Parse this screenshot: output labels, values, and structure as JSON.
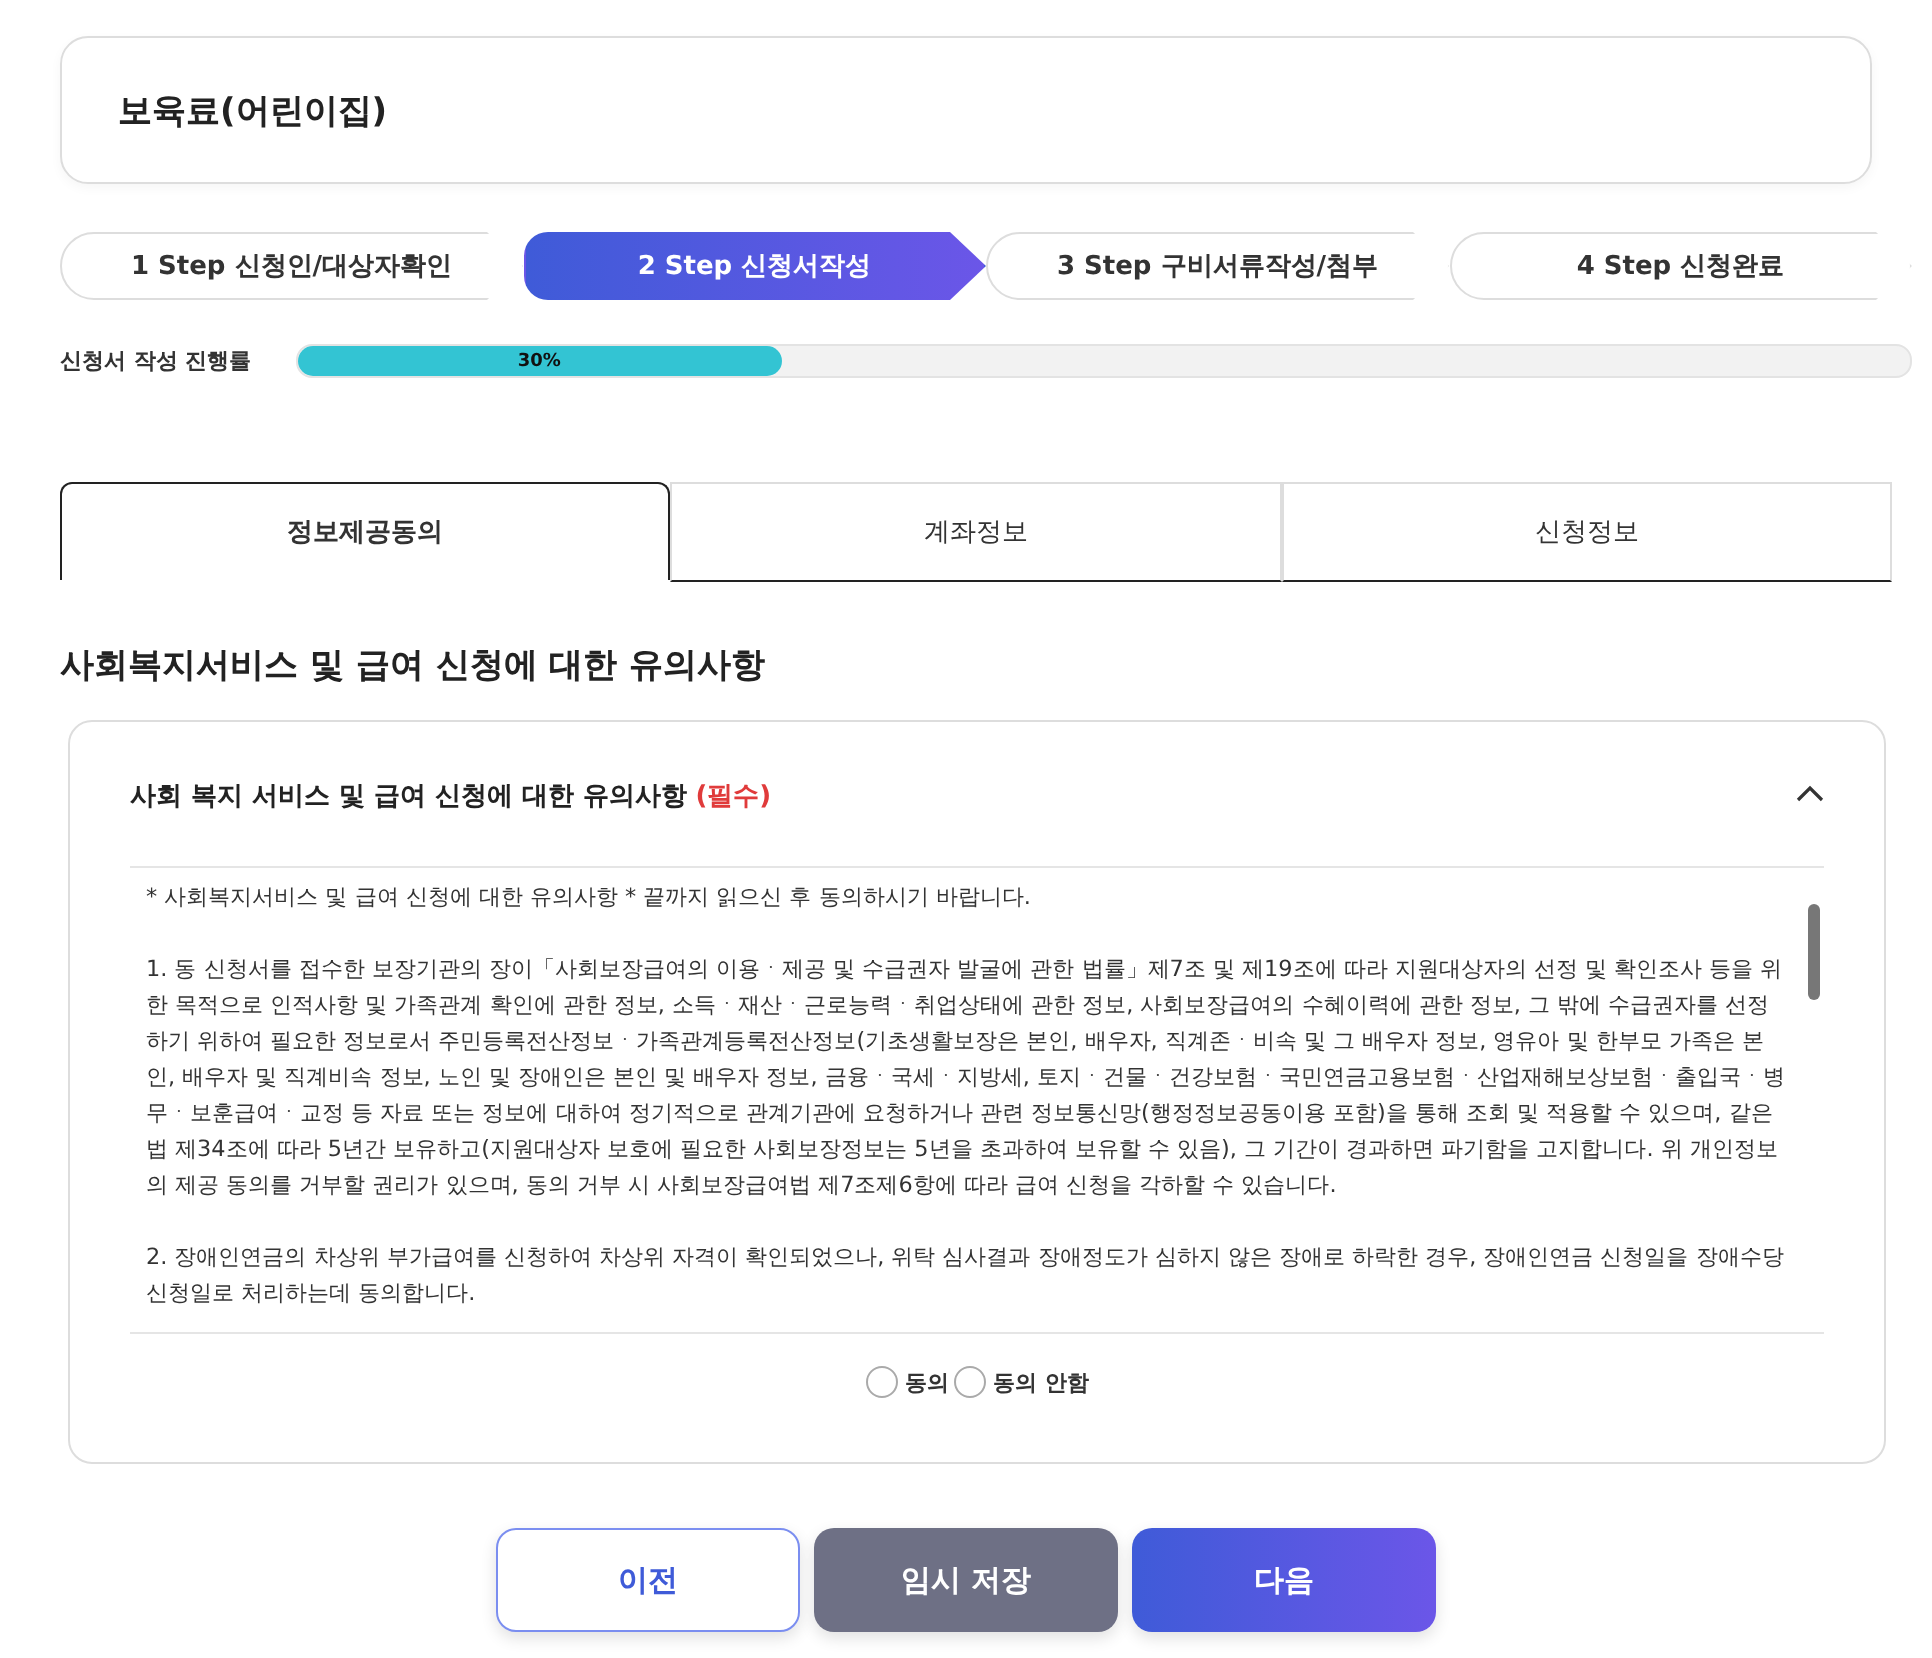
{
  "page_title": "보육료(어린이집)",
  "steps": [
    {
      "label": "1 Step 신청인/대상자확인",
      "selected": false
    },
    {
      "label": "2 Step 신청서작성",
      "selected": true
    },
    {
      "label": "3 Step 구비서류작성/첨부",
      "selected": false
    },
    {
      "label": "4 Step 신청완료",
      "selected": false
    }
  ],
  "progress": {
    "label": "신청서 작성 진행률",
    "level": 0.3,
    "reading": "30%"
  },
  "tabs": [
    {
      "label": "정보제공동의",
      "selected": true
    },
    {
      "label": "계좌정보",
      "selected": false
    },
    {
      "label": "신청정보",
      "selected": false
    }
  ],
  "section_title": "사회복지서비스 및 급여 신청에 대한 유의사항",
  "notice": {
    "title": "사회 복지 서비스 및 급여 신청에 대한 유의사항",
    "required_mark": "(필수)",
    "expanded": true,
    "paragraphs": [
      "* 사회복지서비스 및 급여 신청에 대한 유의사항 * 끝까지 읽으신 후 동의하시기 바랍니다.",
      "1. 동 신청서를 접수한 보장기관의 장이「사회보장급여의 이용ㆍ제공 및 수급권자 발굴에 관한 법률」제7조 및 제19조에 따라 지원대상자의 선정 및 확인조사 등을 위한 목적으로 인적사항 및 가족관계 확인에 관한 정보, 소득ㆍ재산ㆍ근로능력ㆍ취업상태에 관한 정보, 사회보장급여의 수혜이력에 관한 정보, 그 밖에 수급권자를 선정하기 위하여 필요한 정보로서 주민등록전산정보ㆍ가족관계등록전산정보(기초생활보장은 본인, 배우자, 직계존ㆍ비속 및 그 배우자 정보, 영유아 및 한부모 가족은 본인, 배우자 및 직계비속 정보, 노인 및 장애인은 본인 및 배우자 정보, 금융ㆍ국세ㆍ지방세, 토지ㆍ건물ㆍ건강보험ㆍ국민연금고용보험ㆍ산업재해보상보험ㆍ출입국ㆍ병무ㆍ보훈급여ㆍ교정 등 자료 또는 정보에 대하여 정기적으로 관계기관에 요청하거나 관련 정보통신망(행정정보공동이용 포함)을 통해 조회 및 적용할 수 있으며, 같은 법 제34조에 따라 5년간 보유하고(지원대상자 보호에 필요한 사회보장정보는 5년을 초과하여 보유할 수 있음), 그 기간이 경과하면 파기함을 고지합니다. 위 개인정보의 제공 동의를 거부할 권리가 있으며, 동의 거부 시 사회보장급여법 제7조제6항에 따라 급여 신청을 각하할 수 있습니다.",
      "2. 장애인연금의 차상위 부가급여를 신청하여 차상위 자격이 확인되었으나, 위탁 심사결과 장애정도가 심하지 않은 장애로 하락한 경우, 장애인연금 신청일을 장애수당 신청일로 처리하는데 동의합니다."
    ],
    "options": [
      {
        "label": "동의",
        "selected": false
      },
      {
        "label": "동의 안함",
        "selected": false
      }
    ]
  },
  "buttons": [
    {
      "label": "이전",
      "kind": "outline"
    },
    {
      "label": "임시 저장",
      "kind": "gray"
    },
    {
      "label": "다음",
      "kind": "primary"
    }
  ]
}
